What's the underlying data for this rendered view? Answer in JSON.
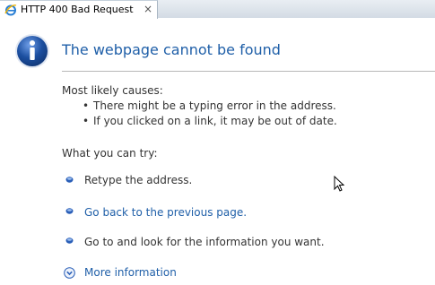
{
  "tab": {
    "title": "HTTP 400 Bad Request",
    "close_glyph": "×",
    "icon": "ie-page-icon"
  },
  "page": {
    "title": "The webpage cannot be found",
    "causes_heading": "Most likely causes:",
    "causes": [
      "There might be a typing error in the address.",
      "If you clicked on a link, it may be out of date."
    ],
    "try_heading": "What you can try:",
    "steps": [
      "Retype the address.",
      "Go back to the previous page.",
      "Go to  and look for the information you want."
    ],
    "more_info": "More information",
    "bullet_glyph": "•"
  },
  "colors": {
    "accent": "#1f5fa8",
    "text": "#333333",
    "info_icon": "#1c4fa0"
  },
  "icons": {
    "info": "info-icon",
    "step_bullet": "blue-bullet-icon",
    "expand": "chevron-down-circle-icon",
    "cursor": "mouse-pointer-icon"
  }
}
